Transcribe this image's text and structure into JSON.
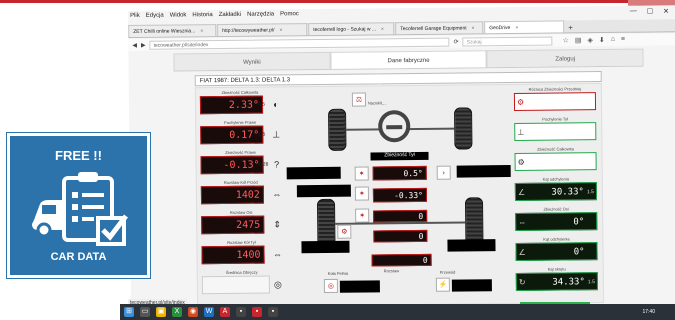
{
  "browser": {
    "menu": [
      "Plik",
      "Edycja",
      "Widok",
      "Historia",
      "Zakładki",
      "Narzędzia",
      "Pomoc"
    ],
    "window_buttons": [
      "—",
      "☐",
      "✕"
    ],
    "tabs": [
      {
        "label": "ZET Chilli online Wiesznia...",
        "active": false
      },
      {
        "label": "http://tecowyweather.pl/",
        "active": false
      },
      {
        "label": "tecoferrell logo - Szukaj w ...",
        "active": false
      },
      {
        "label": "Tecoferrell Garage Equipment",
        "active": false
      },
      {
        "label": "GeoDrive",
        "active": true
      }
    ],
    "new_tab": "+",
    "url": "tecoweather.pl/site/index",
    "search_placeholder": "Szukaj",
    "status_url": "tecoweather.pl/site/index"
  },
  "app": {
    "tabs": [
      {
        "label": "Wyniki",
        "active": false
      },
      {
        "label": "Dane fabryczne",
        "active": true
      },
      {
        "label": "Zaloguj",
        "active": false
      }
    ],
    "vehicle_title": "FIAT 1987: DELTA 1.3: DELTA 1.3",
    "left_gauges": [
      {
        "label": "Zbieżność Całkowita",
        "value": "2.33°",
        "sub": "0.5",
        "cap": ""
      },
      {
        "label": "Pochylenie Prawe",
        "value": "0.17°",
        "sub": "1.5",
        "cap": ""
      },
      {
        "label": "Zbieżność Prawe",
        "value": "-0.13°",
        "sub": "0.26",
        "cap": ""
      },
      {
        "label": "Rozstaw Kół Przód",
        "value": "1402",
        "sub": "",
        "cap": ""
      },
      {
        "label": "Rozstaw Osi",
        "value": "2475",
        "sub": "",
        "cap": ""
      },
      {
        "label": "Rozstaw Kół Tył",
        "value": "1400",
        "sub": "",
        "cap": ""
      },
      {
        "label": "Średnica Obręczy",
        "value": "",
        "sub": "",
        "cap": ""
      }
    ],
    "right_gauges": [
      {
        "label": "Różnica Zbieżności Przedniej",
        "value": "",
        "unit": ""
      },
      {
        "label": "Pochylenie Tył",
        "value": "",
        "unit": ""
      },
      {
        "label": "Zbieżność Całkowita",
        "value": "",
        "unit": ""
      },
      {
        "label": "Kąt odchylenia",
        "value": "30.33°",
        "unit": "1.5"
      },
      {
        "label": "Zbieżność Osi",
        "value": "0°",
        "unit": ""
      },
      {
        "label": "Kąt odchylenia",
        "value": "0°",
        "unit": ""
      },
      {
        "label": "Kąt skrętu",
        "value": "34.33°",
        "unit": "1.5"
      }
    ],
    "center": {
      "top_label": "Nacisk/L...",
      "caster_label": "Zbieżność Tył",
      "center_values": [
        "0.5°",
        "-0.33°",
        "0",
        "0",
        "0"
      ],
      "rear_label": "Rozstaw",
      "bottom_labels": [
        "Koła Pełnia",
        "Przewód"
      ]
    }
  },
  "taskbar": {
    "clock": "17:40"
  },
  "badge": {
    "title": "FREE !!",
    "subtitle": "CAR DATA",
    "icon": "car-checklist-icon",
    "color": "#2c73ab"
  }
}
